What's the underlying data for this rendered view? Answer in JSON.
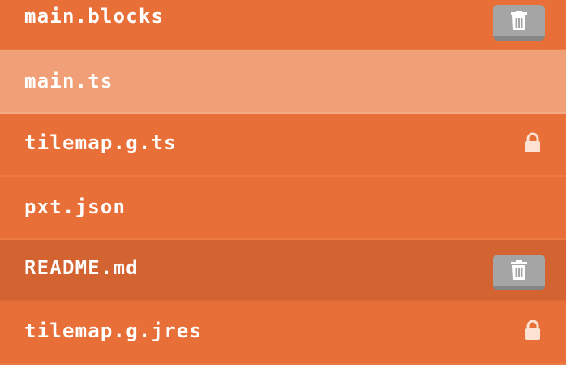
{
  "files": [
    {
      "name": "main.blocks",
      "action": "trash-icon"
    },
    {
      "name": "main.ts",
      "state": "selected"
    },
    {
      "name": "tilemap.g.ts",
      "action": "lock-icon"
    },
    {
      "name": "pxt.json"
    },
    {
      "name": "README.md",
      "state": "hovered",
      "action": "trash-icon"
    },
    {
      "name": "tilemap.g.jres",
      "action": "lock-icon"
    }
  ],
  "colors": {
    "row_background": "#e86f37",
    "row_selected": "#f09f76",
    "row_hovered": "#d36432",
    "button_gray": "#a5a5a5",
    "lock_color": "#fde1d2"
  }
}
